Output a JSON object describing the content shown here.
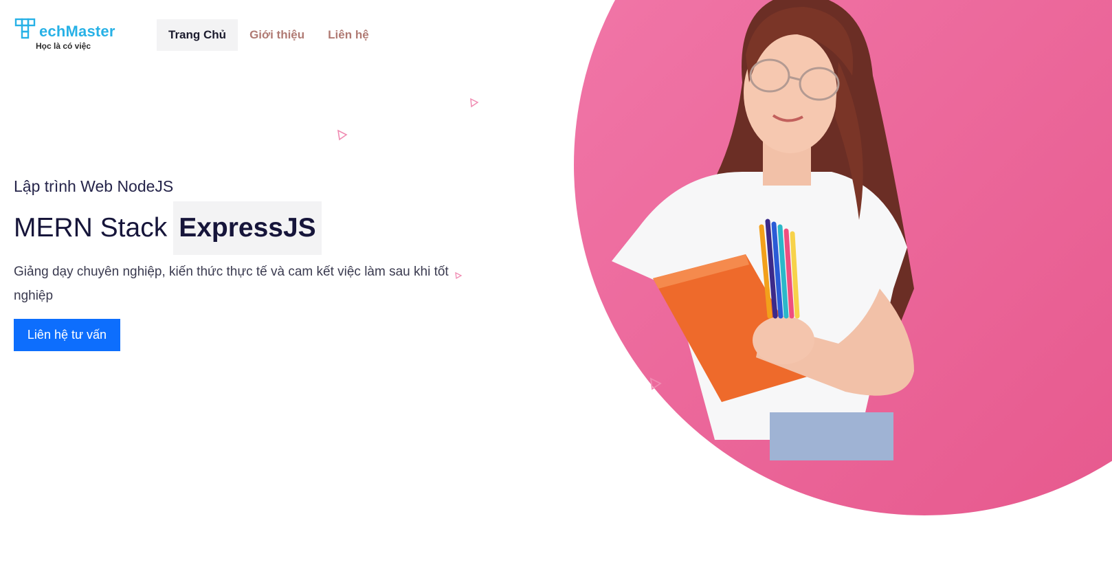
{
  "brand": {
    "name": "TechMaster",
    "name_rest": "echMaster",
    "tagline": "Học là có việc",
    "logo_color": "#27b1e6"
  },
  "nav": {
    "items": [
      {
        "label": "Trang Chủ",
        "active": true
      },
      {
        "label": "Giới thiệu",
        "active": false
      },
      {
        "label": "Liên hệ",
        "active": false
      }
    ]
  },
  "hero": {
    "subtitle": "Lập trình Web NodeJS",
    "title_plain": "MERN Stack",
    "title_highlight": "ExpressJS",
    "description": "Giảng dạy chuyên nghiệp, kiến thức thực tế và cam kết việc làm sau khi tốt nghiệp",
    "cta_label": "Liên hệ tư vấn",
    "cta_color": "#0d6efd",
    "image_backdrop_color": "#ec5f95",
    "decoration_color": "#f08bb2",
    "decoration_icon": "triangle-outline-icon"
  }
}
